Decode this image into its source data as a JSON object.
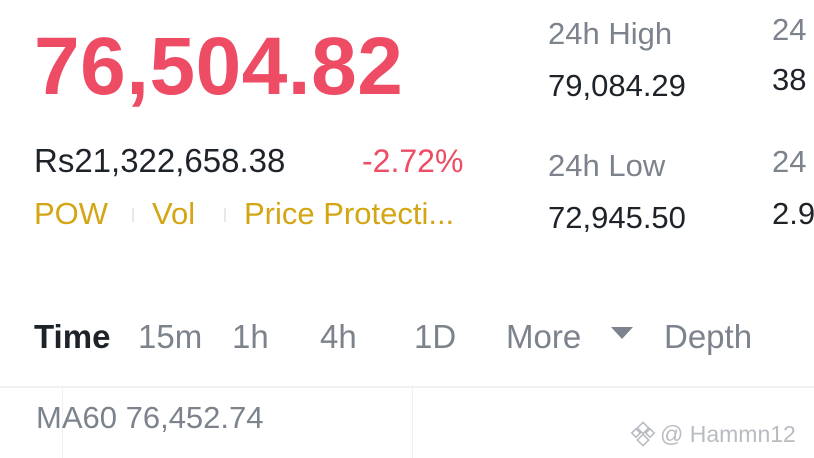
{
  "colors": {
    "down_red": "#ee4c64",
    "tag_gold": "#d4a514",
    "text_primary": "#1e2329",
    "text_secondary": "#7c838c",
    "divider": "#eef0f2",
    "watermark": "#b8bcc1"
  },
  "ticker": {
    "last_price": "76,504.82",
    "fiat_value": "Rs21,322,658.38",
    "change_percent": "-2.72%"
  },
  "tags": [
    "POW",
    "Vol",
    "Price Protecti..."
  ],
  "stats": {
    "high_label": "24h High",
    "high_value": "79,084.29",
    "low_label": "24h Low",
    "low_value": "72,945.50",
    "vol1_label": "24",
    "vol1_value": "38",
    "vol2_label": "24",
    "vol2_value": "2.9"
  },
  "timeframes": {
    "items": [
      "Time",
      "15m",
      "1h",
      "4h",
      "1D",
      "More",
      "Depth"
    ],
    "active": "Time",
    "more_icon": "caret-down-icon"
  },
  "chart": {
    "ma_label": "MA60 76,452.74"
  },
  "watermark": {
    "logo_icon": "binance-logo-icon",
    "text": "@ Hammn12"
  }
}
